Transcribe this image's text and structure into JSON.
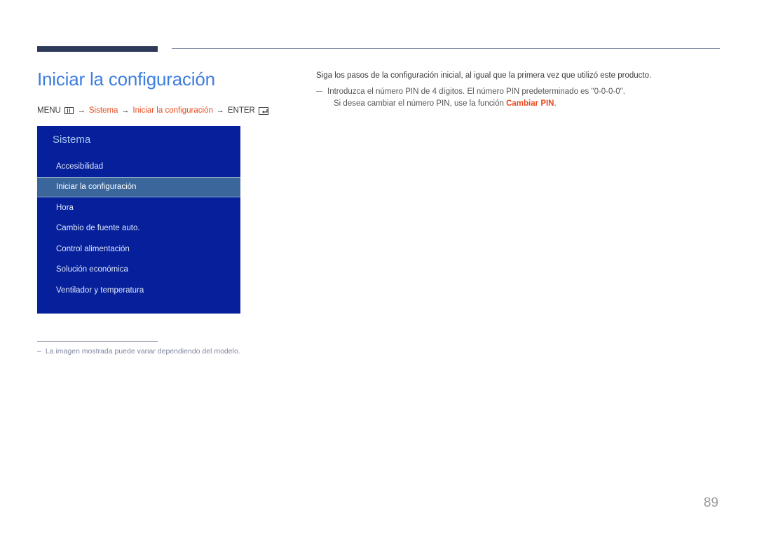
{
  "page": {
    "title": "Iniciar la configuración",
    "number": "89",
    "accent_color": "#e8491d",
    "title_color": "#3d7de0",
    "rule_color": "#2e3a59"
  },
  "breadcrumb": {
    "menu_label": "MENU",
    "menu_icon": "menu-icon",
    "arrow": "→",
    "step_system": "Sistema",
    "step_setup": "Iniciar la configuración",
    "enter_label": "ENTER",
    "enter_icon": "enter-key-icon"
  },
  "osd_menu": {
    "header": "Sistema",
    "background_color": "#06209b",
    "highlight_color": "#3a669c",
    "items": [
      {
        "label": "Accesibilidad",
        "selected": false
      },
      {
        "label": "Iniciar la configuración",
        "selected": true
      },
      {
        "label": "Hora",
        "selected": false
      },
      {
        "label": "Cambio de fuente auto.",
        "selected": false
      },
      {
        "label": "Control alimentación",
        "selected": false
      },
      {
        "label": "Solución económica",
        "selected": false
      },
      {
        "label": "Ventilador y temperatura",
        "selected": false
      }
    ]
  },
  "body": {
    "lead": "Siga los pasos de la configuración inicial, al igual que la primera vez que utilizó este producto.",
    "note_line_1": "Introduzca el número PIN de 4 dígitos. El número PIN predeterminado es \"0-0-0-0\".",
    "note_line_2_prefix": "Si desea cambiar el número PIN, use la función ",
    "note_line_2_accent": "Cambiar PIN",
    "note_line_2_suffix": "."
  },
  "footnote": {
    "dash": "–",
    "text": "La imagen mostrada puede variar dependiendo del modelo."
  }
}
